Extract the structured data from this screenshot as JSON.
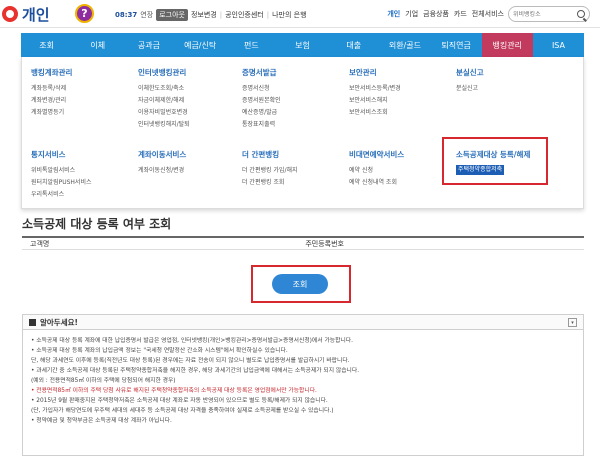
{
  "header": {
    "logo_text": "개인",
    "help_label": "?",
    "timer": "08:37",
    "extend": "연장",
    "logout": "로그아웃",
    "util_links": [
      "정보변경",
      "공인인증센터",
      "나만의 은행"
    ],
    "right_links": [
      "개인",
      "기업",
      "금융상품",
      "카드",
      "전체서비스"
    ],
    "search_placeholder": "위비뱅킹소"
  },
  "nav": {
    "items": [
      "조회",
      "이체",
      "공과금",
      "예금/신탁",
      "펀드",
      "보험",
      "대출",
      "외환/골드",
      "퇴직연금",
      "뱅킹관리",
      "ISA"
    ]
  },
  "mega": {
    "col1": {
      "head": "뱅킹계좌관리",
      "links": [
        "계좌등록/삭제",
        "계좌변경/관리",
        "계좌별명등기"
      ]
    },
    "col2": {
      "head": "인터넷뱅킹관리",
      "links": [
        "이체한도조회/축소",
        "자금이체제한/해제",
        "이용자비밀번호변경",
        "인터넷뱅킹해지/탈퇴"
      ]
    },
    "col3": {
      "head": "증명서발급",
      "links": [
        "증명서신청",
        "증명서원본확인",
        "예산증명/발급",
        "통장표지출력"
      ]
    },
    "col4": {
      "head": "보안관리",
      "links": [
        "보안서비스등록/변경",
        "보안서비스해지",
        "보안서비스조회"
      ]
    },
    "col5": {
      "head": "분실신고",
      "links": [
        "분실신고"
      ]
    },
    "col6": {
      "head": "통지서비스",
      "links": [
        "위비톡알림서비스",
        "원터치알림PUSH서비스",
        "우리톡서비스"
      ]
    },
    "col7": {
      "head": "계좌이동서비스",
      "links": [
        "계좌이동신청/변경"
      ]
    },
    "col8": {
      "head": "더 간편뱅킹",
      "links": [
        "더 간편뱅킹 가입/해지",
        "더 간편뱅킹 조회"
      ]
    },
    "col9": {
      "head": "비대면예약서비스",
      "links": [
        "예약 신청",
        "예약 신청내역 조회"
      ]
    },
    "col10": {
      "head": "소득공제대상 등록/해제",
      "links": [
        "주택청약종합저축"
      ]
    }
  },
  "page": {
    "title": "소득공제 대상 등록 여부 조회",
    "form_label_1": "고객명",
    "form_label_2": "주민등록번호",
    "lookup_button": "조회"
  },
  "notice": {
    "title": "알아두세요!",
    "toggle": "▾",
    "lines": [
      "• 소득공제 대상 등록 계좌에 대한 납입증명서 발급은 영업점, 인터넷뱅킹(개인>뱅킹관리>증명서발급>증명서신청)에서 가능합니다.",
      "• 소득공제 대상 등록 계좌의 납입금액 정보는 \"국세청 연말정산 간소화 시스템\"에서 확인하실수 있습니다.",
      "  단, 해당 과세연도 이후에 등록(직전년도 대상 등록)된 경우에는 자료 전송이 되지 않으니 별도로 납입증명서를 발급하시기 바랍니다.",
      "• 과세기간 중 소득공제 대상 등록된 주택청약종합저축을 해지한 경우, 해당 과세기간의 납입금액에 대해서는 소득공제가 되지 않습니다.",
      "  (예외 : 전용면적85㎡ 이하의 주택에 당첨되어 해지한 경우)",
      "• 전용면적85㎡ 이하의 주택 당첨 사유로 해지된 주택청약종합저축의 소득공제 대상 등록은 영업점에서만 가능합니다.",
      "• 2015년 9월 판매중지된 주택청약저축은 소득공제 대상 계좌로 자동 반영되어 있으므로 별도 등록/해제가 되지 않습니다.",
      "  (단, 가입자가 해당연도에 무주택 세대의 세대주 등 소득공제 대상 자격을 충족하여야 실제로 소득공제를 받으실 수 있습니다.)",
      "• 청약예금 및 청약부금은 소득공제 대상 계좌가 아닙니다."
    ]
  },
  "colors": {
    "nav_blue": "#1f8fd6",
    "nav_active": "#c23a5d",
    "highlight_red": "#d7282f",
    "button_blue": "#2e86d4"
  }
}
